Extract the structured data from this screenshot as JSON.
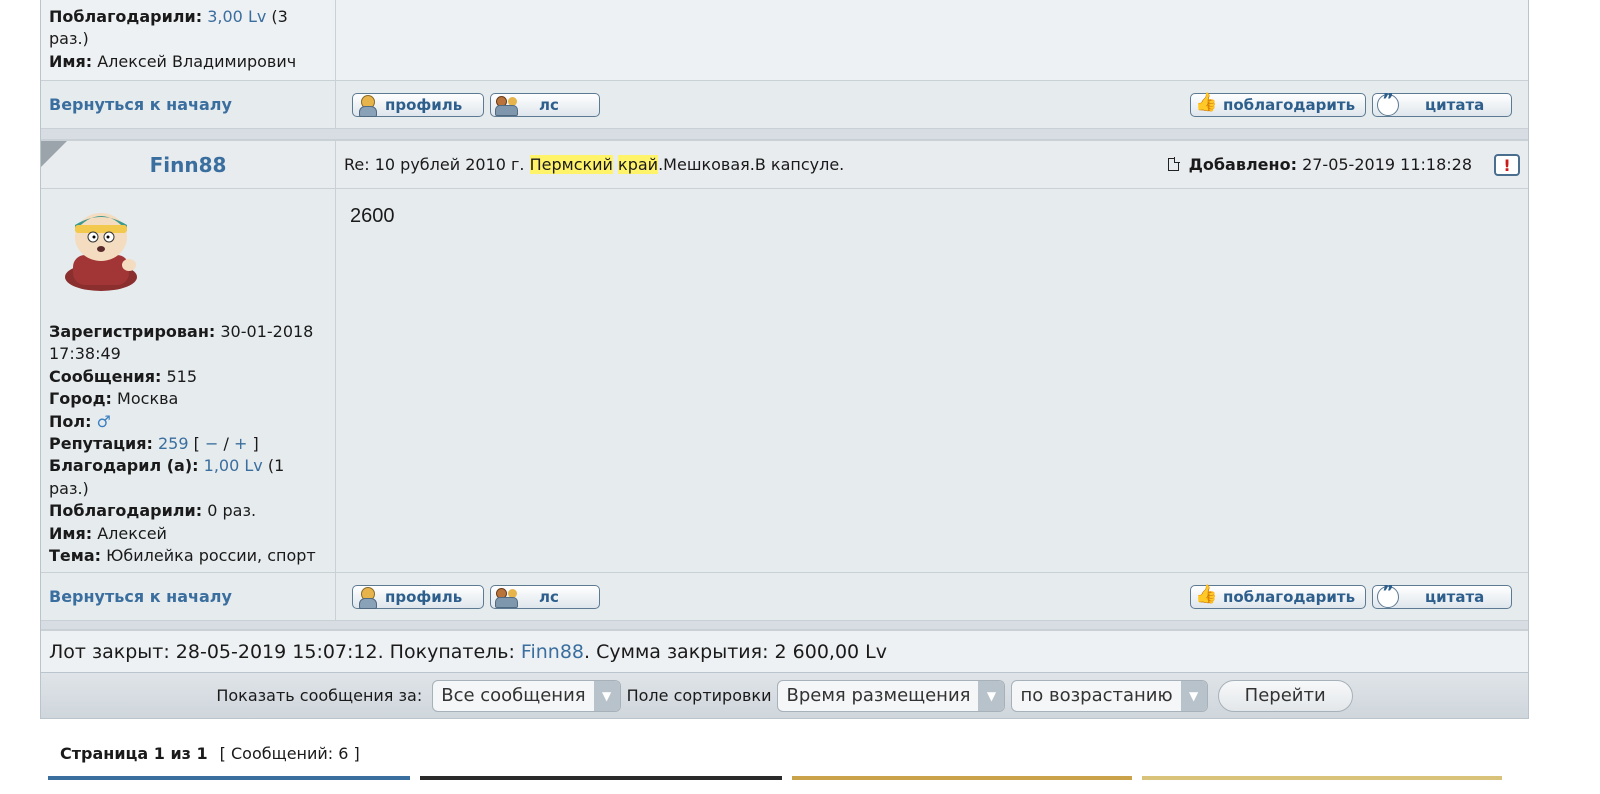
{
  "post1": {
    "thanked_label": "Поблагодарили:",
    "thanked_value": "3,00 Lv",
    "thanked_suffix": "(3 раз.)",
    "name_label": "Имя:",
    "name_value": "Алексей Владимирович"
  },
  "nav": {
    "back_to_top": "Вернуться к началу",
    "profile": "профиль",
    "pm": "лс",
    "thank": "поблагодарить",
    "quote": "цитата"
  },
  "post2": {
    "author": "Finn88",
    "subject_prefix": "Re: 10 рублей 2010 г. ",
    "subject_hl1": "Пермский",
    "subject_hl2": "край",
    "subject_suffix": ".Мешковая.В капсуле.",
    "added_label": "Добавлено:",
    "added_value": "27-05-2019 11:18:28",
    "report_glyph": "!",
    "body": "2600",
    "registered_label": "Зарегистрирован:",
    "registered_value": "30-01-2018 17:38:49",
    "messages_label": "Сообщения:",
    "messages_value": "515",
    "city_label": "Город:",
    "city_value": "Москва",
    "gender_label": "Пол:",
    "gender_symbol": "♂",
    "reputation_label": "Репутация:",
    "reputation_value": "259",
    "reputation_open": "[",
    "reputation_minus": "−",
    "reputation_slash": "/",
    "reputation_plus": "+",
    "reputation_close": "]",
    "thanked_by_label": "Благодарил (а):",
    "thanked_by_value": "1,00 Lv",
    "thanked_by_suffix": "(1 раз.)",
    "thanked_label": "Поблагодарили:",
    "thanked_value": "0 раз.",
    "name_label": "Имя:",
    "name_value": "Алексей",
    "topic_label": "Тема:",
    "topic_value": "Юбилейка россии, спорт"
  },
  "lot": {
    "prefix": "Лот закрыт: 28-05-2019 15:07:12. Покупатель: ",
    "buyer": "Finn88",
    "suffix": ". Сумма закрытия: 2 600,00 Lv"
  },
  "sort": {
    "show_label": "Показать сообщения за:",
    "show_value": "Все сообщения",
    "field_label": "Поле сортировки",
    "field_value": "Время размещения",
    "order_value": "по возрастанию",
    "go": "Перейти"
  },
  "pagination": {
    "page": "Страница 1 из 1",
    "count": "[ Сообщений: 6 ]"
  }
}
